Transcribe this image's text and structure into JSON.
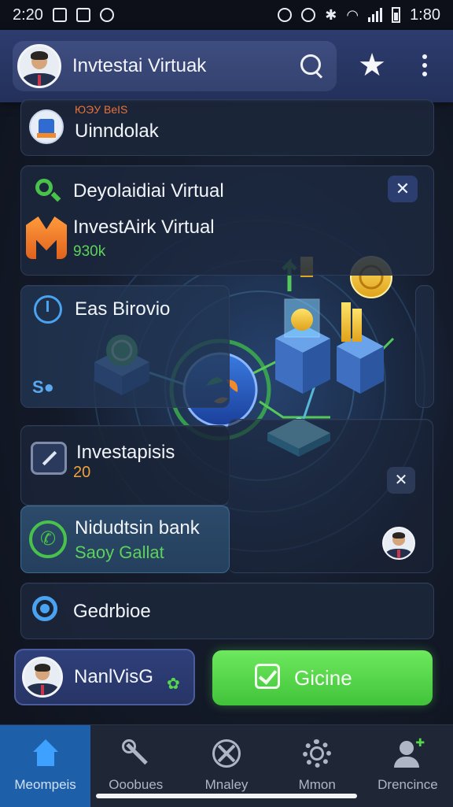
{
  "status_bar": {
    "time_left": "2:20",
    "time_right": "1:80"
  },
  "app_bar": {
    "search_title": "Invtestai Virtuak"
  },
  "cards": {
    "card1": {
      "top_label": "ЮЭУ ВеIS",
      "label": "Uinndolak"
    },
    "card2": {
      "label": "Deyolaidiai Virtual",
      "sub_label": "InvestAirk Virtual",
      "value": "930k"
    },
    "card3": {
      "label": "Eas Birovio",
      "code": "S●"
    },
    "card4": {
      "label": "Investapisis",
      "value": "20"
    },
    "card5": {
      "label": "Nidudtsin bank",
      "sub_label": "Saoy Gallat"
    },
    "card6": {
      "label": "Gedrbioe"
    }
  },
  "actions": {
    "left_button": "NanlVisG",
    "right_button": "Gicine"
  },
  "bottom_nav": {
    "items": [
      {
        "label": "Meompeis",
        "icon": "home-icon",
        "active": true
      },
      {
        "label": "Ooobues",
        "icon": "tools-icon",
        "active": false
      },
      {
        "label": "Mnaley",
        "icon": "compass-icon",
        "active": false
      },
      {
        "label": "Mmon",
        "icon": "gear-icon",
        "active": false
      },
      {
        "label": "Drencince",
        "icon": "user-add-icon",
        "active": false
      }
    ]
  },
  "colors": {
    "accent_green": "#55d84a",
    "accent_blue": "#2f6bd0",
    "appbar": "#2d3c6e"
  }
}
